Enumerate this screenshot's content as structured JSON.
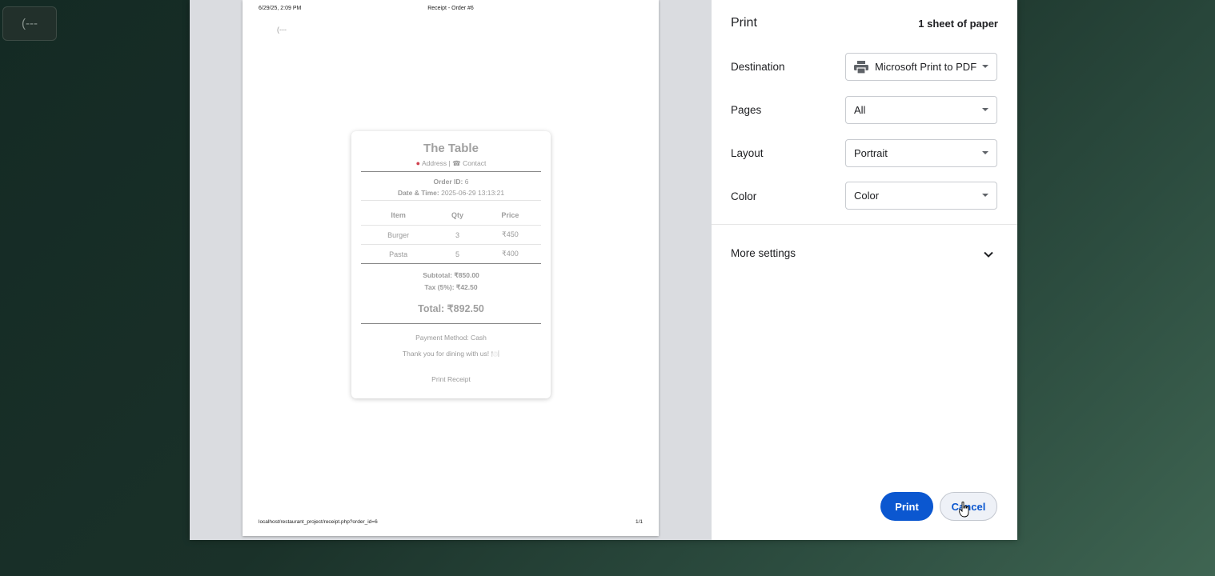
{
  "back_button": {
    "label": "(---"
  },
  "preview": {
    "header_date": "6/29/25, 2:09 PM",
    "header_title": "Receipt - Order #6",
    "back_link": "(---",
    "footer_url": "localhost/restaurant_project/receipt.php?order_id=6",
    "footer_page": "1/1",
    "receipt": {
      "title": "The Table",
      "address": "Address",
      "contact": "Contact",
      "order_label": "Order ID:",
      "order_value": "6",
      "date_label": "Date & Time:",
      "date_value": "2025-06-29 13:13:21",
      "columns": [
        "Item",
        "Qty",
        "Price"
      ],
      "rows": [
        {
          "item": "Burger",
          "qty": "3",
          "price": "₹450"
        },
        {
          "item": "Pasta",
          "qty": "5",
          "price": "₹400"
        }
      ],
      "subtotal": "Subtotal: ₹850.00",
      "tax": "Tax (5%): ₹42.50",
      "total": "Total: ₹892.50",
      "payment": "Payment Method: Cash",
      "thanks": "Thank you for dining with us! 🍽️",
      "print_label": "Print Receipt"
    }
  },
  "settings": {
    "title": "Print",
    "sheets": "1 sheet of paper",
    "destination_label": "Destination",
    "destination_value": "Microsoft Print to PDF",
    "pages_label": "Pages",
    "pages_value": "All",
    "layout_label": "Layout",
    "layout_value": "Portrait",
    "color_label": "Color",
    "color_value": "Color",
    "more_settings": "More settings",
    "print_button": "Print",
    "cancel_button": "Cancel"
  },
  "colors": {
    "accent": "#0b57d0"
  }
}
